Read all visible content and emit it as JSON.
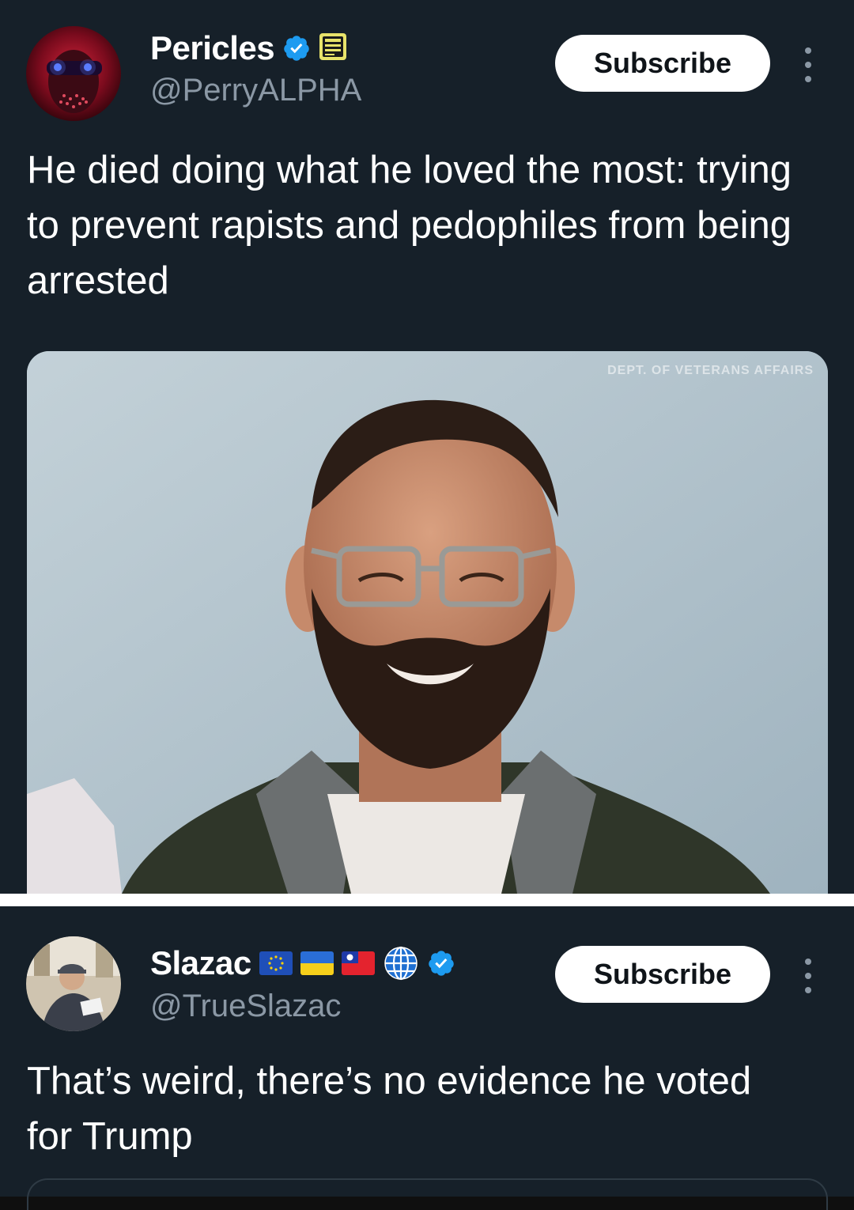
{
  "posts": [
    {
      "author": {
        "display_name": "Pericles",
        "handle": "@PerryALPHA",
        "badges": [
          "verified-badge",
          "affiliate-badge"
        ]
      },
      "subscribe_label": "Subscribe",
      "text": "He died doing what he loved the most: trying to prevent rapists and pedophiles from being arrested",
      "media": {
        "watermark": "DEPT. OF VETERANS AFFAIRS"
      }
    },
    {
      "author": {
        "display_name": "Slazac",
        "handle": "@TrueSlazac",
        "badges": [
          "eu-flag-icon",
          "ukraine-flag-icon",
          "taiwan-flag-icon",
          "globe-icon",
          "verified-badge"
        ]
      },
      "subscribe_label": "Subscribe",
      "text": "That’s weird, there’s no evidence he voted for Trump"
    }
  ],
  "colors": {
    "background": "#162029",
    "verified": "#1d9bf0",
    "handle": "#8b98a5",
    "button_bg": "#ffffff",
    "divider": "#ffffff"
  }
}
